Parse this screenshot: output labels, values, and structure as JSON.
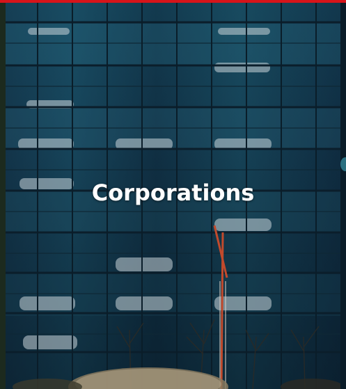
{
  "card": {
    "title": "Corporations",
    "accent_color": "#d7141a",
    "image_subject": "glass-car-tower-photo"
  }
}
